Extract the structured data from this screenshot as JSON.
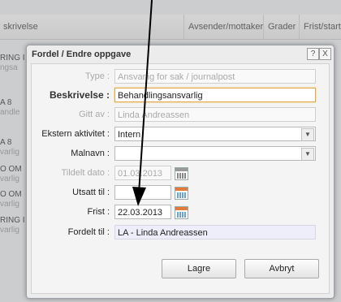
{
  "background": {
    "columns": [
      "skrivelse",
      "Avsender/mottaker",
      "Grader",
      "Frist/starte"
    ],
    "rows": [
      {
        "l1": "RING I",
        "l2": "ngsa"
      },
      {
        "l1": "A 8",
        "l2": "andle"
      },
      {
        "l1": "A 8",
        "l2": "varlig"
      },
      {
        "l1": "O OM",
        "l2": "varlig"
      },
      {
        "l1": "O OM",
        "l2": "varlig"
      },
      {
        "l1": "RING I",
        "l2": "varlig"
      }
    ]
  },
  "dialog": {
    "title": "Fordel / Endre oppgave",
    "help_label": "?",
    "close_label": "X",
    "fields": {
      "type": {
        "label": "Type :",
        "value": "Ansvarlig for sak / journalpost"
      },
      "beskrivelse": {
        "label": "Beskrivelse :",
        "value": "Behandlingsansvarlig"
      },
      "gitt_av": {
        "label": "Gitt av :",
        "value": "Linda Andreassen"
      },
      "ekstern": {
        "label": "Ekstern aktivitet :",
        "value": "Intern"
      },
      "malnavn": {
        "label": "Malnavn :",
        "value": ""
      },
      "tildelt": {
        "label": "Tildelt dato :",
        "value": "01.03.2013"
      },
      "utsatt": {
        "label": "Utsatt til :",
        "value": ""
      },
      "frist": {
        "label": "Frist :",
        "value": "22.03.2013"
      },
      "fordelt": {
        "label": "Fordelt til :",
        "value": "LA - Linda  Andreassen"
      }
    },
    "buttons": {
      "save": "Lagre",
      "cancel": "Avbryt"
    }
  }
}
